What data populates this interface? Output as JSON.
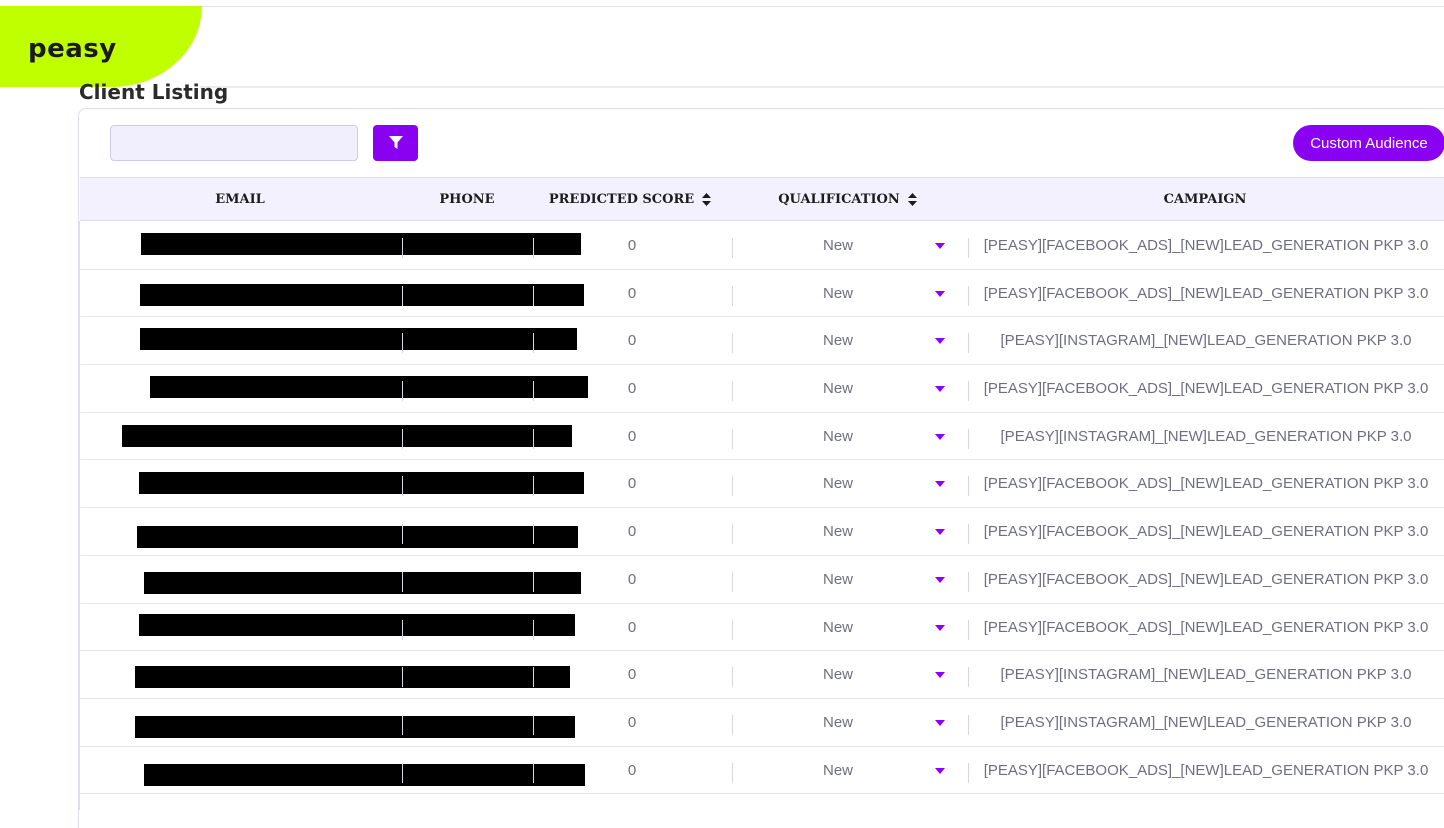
{
  "brand": {
    "logo_text": "peasy",
    "logo_color": "#bfff00"
  },
  "page": {
    "title": "Client Listing"
  },
  "toolbar": {
    "search_placeholder": "",
    "filter_icon": "filter-icon",
    "custom_audience_label": "Custom Audience"
  },
  "colors": {
    "accent": "#8a00f0",
    "header_bg": "#f2f1fd"
  },
  "table": {
    "headers": {
      "email": "EMAIL",
      "phone": "PHONE",
      "predicted_score": "PREDICTED SCORE",
      "qualification": "QUALIFICATION",
      "campaign": "CAMPAIGN"
    },
    "rows": [
      {
        "score": "0",
        "qualification": "New",
        "campaign": "[PEASY][FACEBOOK_ADS]_[NEW]LEAD_GENERATION PKP 3.0"
      },
      {
        "score": "0",
        "qualification": "New",
        "campaign": "[PEASY][FACEBOOK_ADS]_[NEW]LEAD_GENERATION PKP 3.0"
      },
      {
        "score": "0",
        "qualification": "New",
        "campaign": "[PEASY][INSTAGRAM]_[NEW]LEAD_GENERATION PKP 3.0"
      },
      {
        "score": "0",
        "qualification": "New",
        "campaign": "[PEASY][FACEBOOK_ADS]_[NEW]LEAD_GENERATION PKP 3.0"
      },
      {
        "score": "0",
        "qualification": "New",
        "campaign": "[PEASY][INSTAGRAM]_[NEW]LEAD_GENERATION PKP 3.0"
      },
      {
        "score": "0",
        "qualification": "New",
        "campaign": "[PEASY][FACEBOOK_ADS]_[NEW]LEAD_GENERATION PKP 3.0"
      },
      {
        "score": "0",
        "qualification": "New",
        "campaign": "[PEASY][FACEBOOK_ADS]_[NEW]LEAD_GENERATION PKP 3.0"
      },
      {
        "score": "0",
        "qualification": "New",
        "campaign": "[PEASY][FACEBOOK_ADS]_[NEW]LEAD_GENERATION PKP 3.0"
      },
      {
        "score": "0",
        "qualification": "New",
        "campaign": "[PEASY][FACEBOOK_ADS]_[NEW]LEAD_GENERATION PKP 3.0"
      },
      {
        "score": "0",
        "qualification": "New",
        "campaign": "[PEASY][INSTAGRAM]_[NEW]LEAD_GENERATION PKP 3.0"
      },
      {
        "score": "0",
        "qualification": "New",
        "campaign": "[PEASY][INSTAGRAM]_[NEW]LEAD_GENERATION PKP 3.0"
      },
      {
        "score": "0",
        "qualification": "New",
        "campaign": "[PEASY][FACEBOOK_ADS]_[NEW]LEAD_GENERATION PKP 3.0"
      }
    ]
  }
}
